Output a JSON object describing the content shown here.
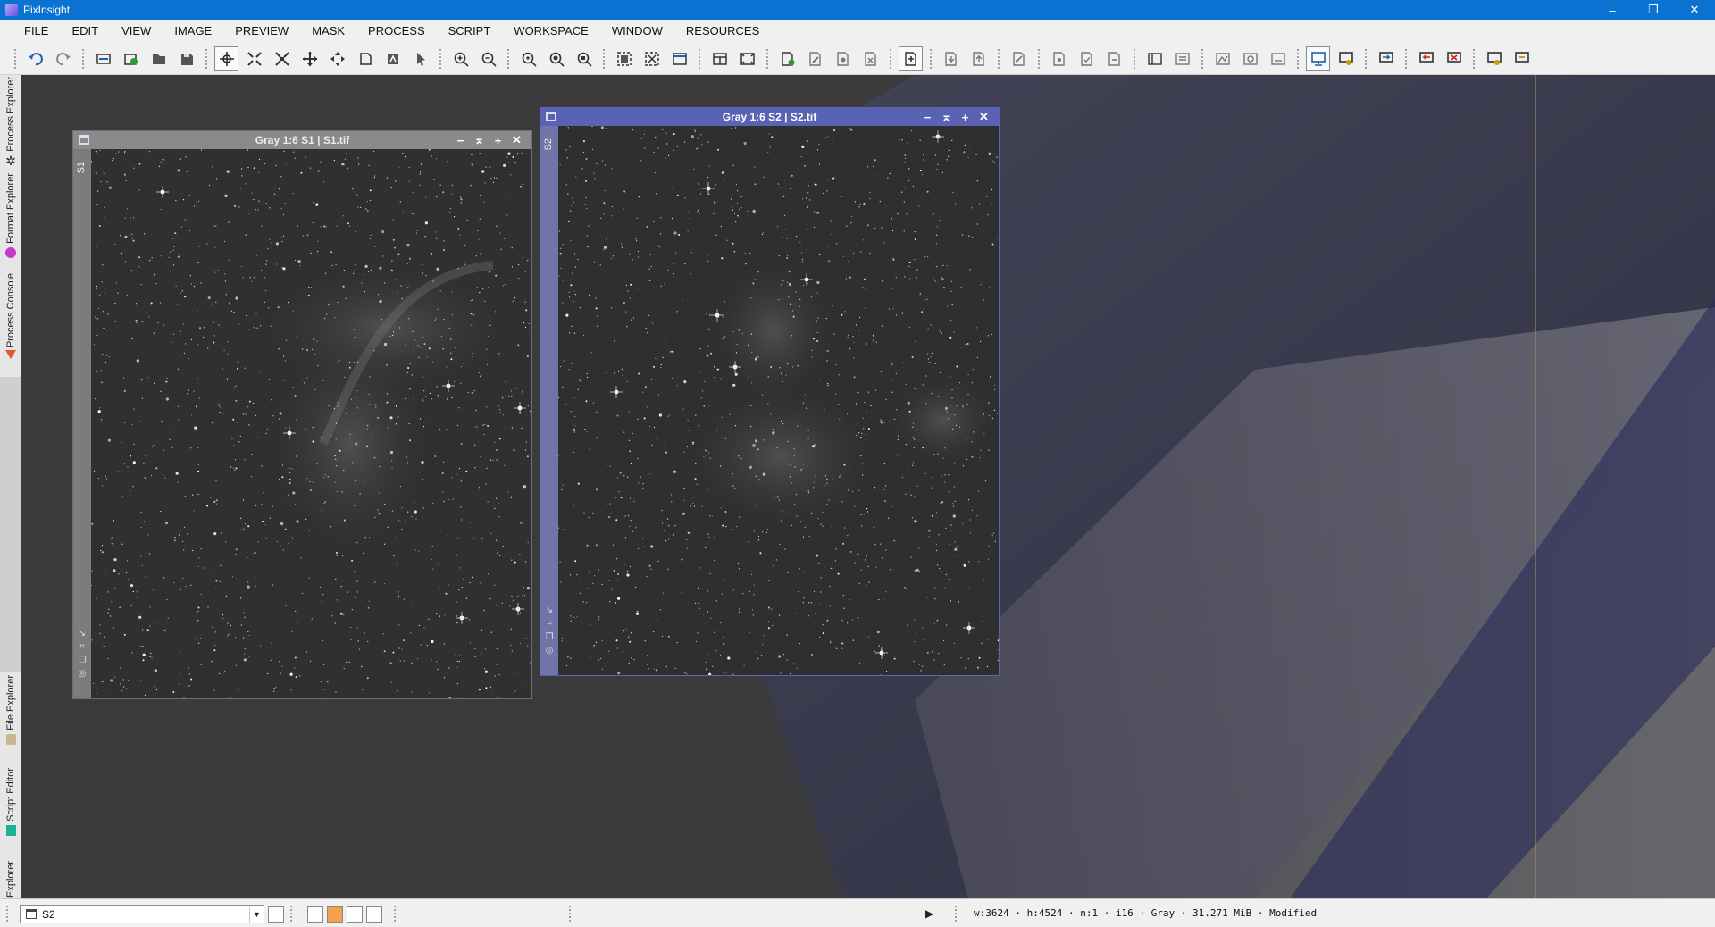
{
  "app": {
    "title": "PixInsight"
  },
  "window_controls": {
    "minimize": "–",
    "restore": "❐",
    "close": "✕"
  },
  "menu": [
    "FILE",
    "EDIT",
    "VIEW",
    "IMAGE",
    "PREVIEW",
    "MASK",
    "PROCESS",
    "SCRIPT",
    "WORKSPACE",
    "WINDOW",
    "RESOURCES"
  ],
  "side_tabs": [
    {
      "label": "Process Explorer",
      "icon": "gear-icon",
      "color": "#222222"
    },
    {
      "label": "Format Explorer",
      "icon": "format-icon",
      "color": "#c03cc8"
    },
    {
      "label": "Process Console",
      "icon": "console-icon",
      "color": "#e05a2a"
    },
    {
      "label": "File Explorer",
      "icon": "file-icon",
      "color": "#c8b58a"
    },
    {
      "label": "Script Editor",
      "icon": "script-icon",
      "color": "#19b394"
    },
    {
      "label": "History Explorer",
      "icon": "history-icon",
      "color": "#e0702a"
    }
  ],
  "image_windows": [
    {
      "id": "S1",
      "title": "Gray 1:6 S1 | S1.tif",
      "active": false
    },
    {
      "id": "S2",
      "title": "Gray 1:6 S2 | S2.tif",
      "active": true
    }
  ],
  "image_controls": {
    "minimize": "−",
    "shade": "⌅",
    "maximize": "+",
    "close": "✕"
  },
  "status": {
    "current_view": "S2",
    "info": "w:3624 · h:4524 · n:1 · i16 · Gray · 31.271 MiB · Modified",
    "mask_colors": [
      "#ffffff",
      "#f3a24b",
      "#ffffff",
      "#ffffff"
    ]
  },
  "colors": {
    "title_bar": "#0a72d0",
    "active_window": "#5a63b3",
    "inactive_window": "#8a8a8a"
  }
}
